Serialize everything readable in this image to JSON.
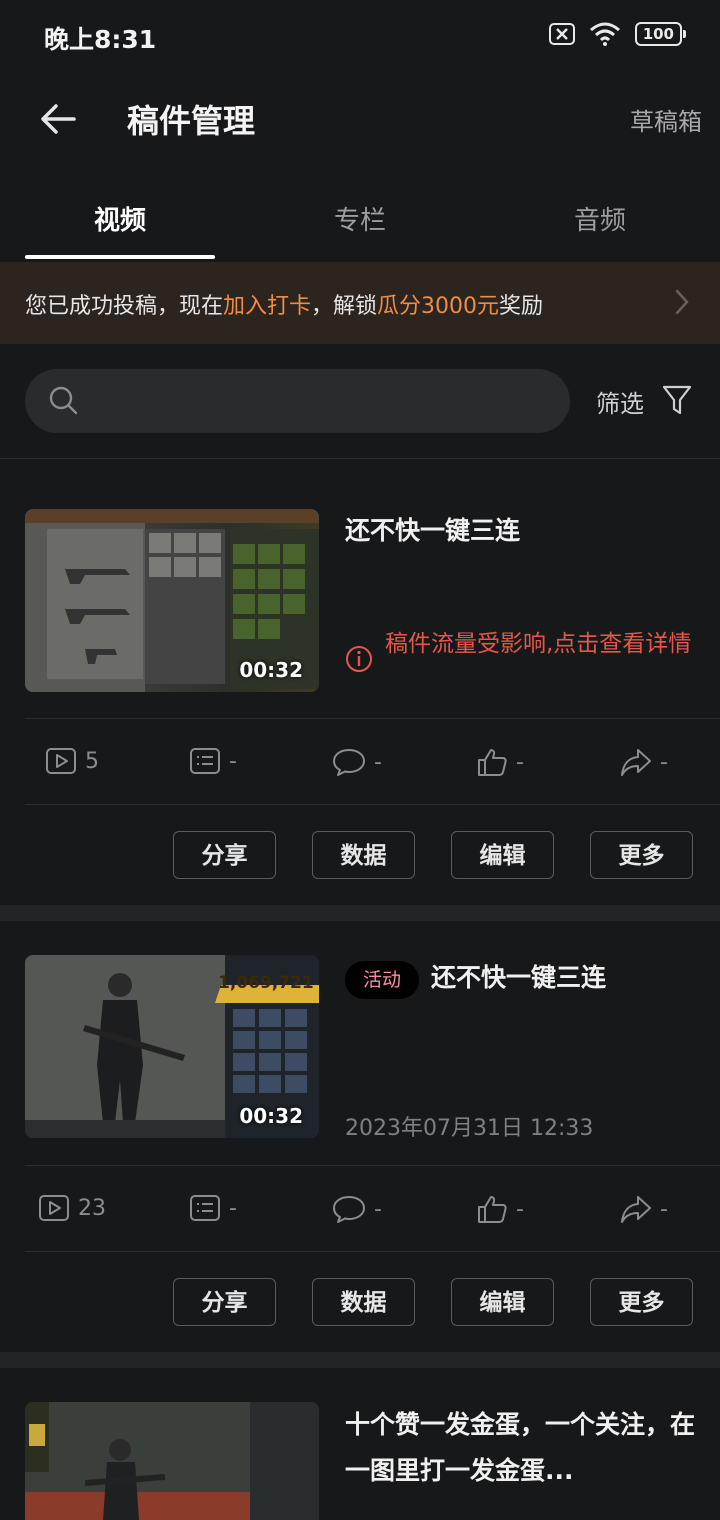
{
  "status_bar": {
    "time": "晚上8:31",
    "battery": "100"
  },
  "header": {
    "title": "稿件管理",
    "drafts_label": "草稿箱"
  },
  "tabs": [
    {
      "label": "视频",
      "active": true
    },
    {
      "label": "专栏",
      "active": false
    },
    {
      "label": "音频",
      "active": false
    }
  ],
  "banner": {
    "part1": "您已成功投稿，现在",
    "link1": "加入打卡",
    "part2": "，解锁",
    "link2": "瓜分3000元",
    "part3": "奖励",
    "accent_color": "#f08c45"
  },
  "search": {
    "placeholder": "",
    "value": ""
  },
  "filter_label": "筛选",
  "cards": [
    {
      "title": "还不快一键三连",
      "duration": "00:32",
      "warning": "稿件流量受影响,点击查看详情",
      "stats": {
        "plays": "5",
        "danmaku": "-",
        "comments": "-",
        "likes": "-",
        "shares": "-"
      },
      "buttons": [
        "分享",
        "数据",
        "编辑",
        "更多"
      ]
    },
    {
      "badge": "活动",
      "title": "还不快一键三连",
      "duration": "00:32",
      "date": "2023年07月31日 12:33",
      "thumb_overlay_value": "1,069,721",
      "stats": {
        "plays": "23",
        "danmaku": "-",
        "comments": "-",
        "likes": "-",
        "shares": "-"
      },
      "buttons": [
        "分享",
        "数据",
        "编辑",
        "更多"
      ]
    },
    {
      "title": "十个赞一发金蛋，一个关注，在一图里打一发金蛋..."
    }
  ],
  "colors": {
    "background": "#17181a",
    "warning": "#e5574b",
    "badge_text": "#ff8aa6"
  }
}
